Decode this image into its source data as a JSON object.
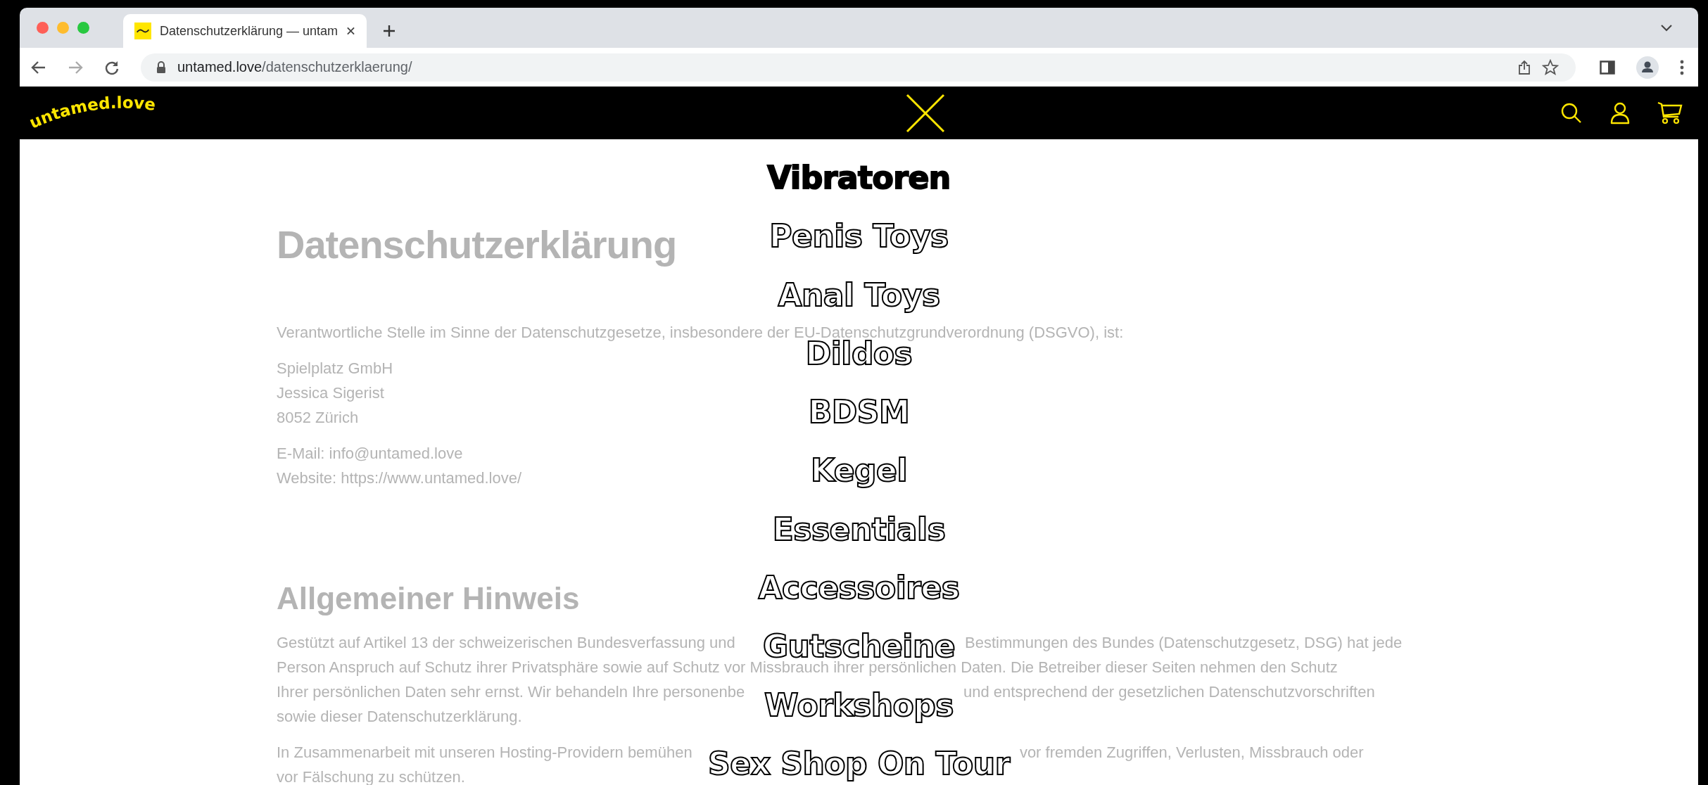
{
  "browser": {
    "tab": {
      "title": "Datenschutzerklärung — untam"
    },
    "url": {
      "host": "untamed.love",
      "path": "/datenschutzerklaerung/"
    }
  },
  "site": {
    "logo": "untamed.love",
    "menu": [
      {
        "label": "Vibratoren",
        "selected": true
      },
      {
        "label": "Penis Toys",
        "selected": false
      },
      {
        "label": "Anal Toys",
        "selected": false
      },
      {
        "label": "Dildos",
        "selected": false
      },
      {
        "label": "BDSM",
        "selected": false
      },
      {
        "label": "Kegel",
        "selected": false
      },
      {
        "label": "Essentials",
        "selected": false
      },
      {
        "label": "Accessoires",
        "selected": false
      },
      {
        "label": "Gutscheine",
        "selected": false
      },
      {
        "label": "Workshops",
        "selected": false
      },
      {
        "label": "Sex Shop On Tour",
        "selected": false
      }
    ]
  },
  "page": {
    "sections": [
      {
        "heading": "Datenschutzerklärung",
        "kind": "display",
        "blocks": [
          {
            "lines": [
              [
                "Verantwortliche Stelle im Sinne der Datenschutzgesetze, insbesondere der EU-Datenschutzgrundverordnung (DSGVO), ist:"
              ]
            ]
          },
          {
            "lines": [
              [
                "Spielplatz GmbH"
              ],
              [
                "Jessica Sigerist"
              ],
              [
                "8052 Zürich"
              ]
            ]
          },
          {
            "lines": [
              [
                "E-Mail: info@untamed.love"
              ],
              [
                "Website: https://www.untamed.love/"
              ]
            ]
          }
        ]
      },
      {
        "heading": "Allgemeiner Hinweis",
        "kind": "plain",
        "blocks": [
          {
            "lines": [
              [
                "Gestützt auf Artikel 13 der schweizerischen Bundesverfassung und",
                "Bestimmungen des Bundes (Datenschutzgesetz, DSG) hat jede"
              ],
              [
                "Person Anspruch auf Schutz ihrer Privatsphäre sowie auf Schutz vor Missbrauch ihrer persönlichen Daten. Die Betreiber dieser Seiten nehmen den Schutz"
              ],
              [
                "Ihrer persönlichen Daten sehr ernst. Wir behandeln Ihre personenbe",
                "und entsprechend der gesetzlichen Datenschutzvorschriften"
              ],
              [
                "sowie dieser Datenschutzerklärung."
              ]
            ]
          },
          {
            "lines": [
              [
                "In Zusammenarbeit mit unseren Hosting-Providern bemühen",
                "vor fremden Zugriffen, Verlusten, Missbrauch oder"
              ],
              [
                "vor Fälschung zu schützen."
              ]
            ]
          }
        ]
      }
    ]
  }
}
